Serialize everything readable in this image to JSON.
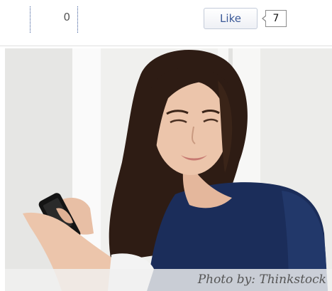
{
  "share_bar": {
    "share_count": "0",
    "like_label": "Like",
    "like_count": "7"
  },
  "photo": {
    "caption": "Photo by: Thinkstock",
    "subject_icon": "woman-with-phone-photo"
  },
  "colors": {
    "facebook_blue": "#3b5998",
    "shirt_navy": "#1b2d5a",
    "hair": "#2e1c14",
    "skin": "#e8bfa5"
  }
}
